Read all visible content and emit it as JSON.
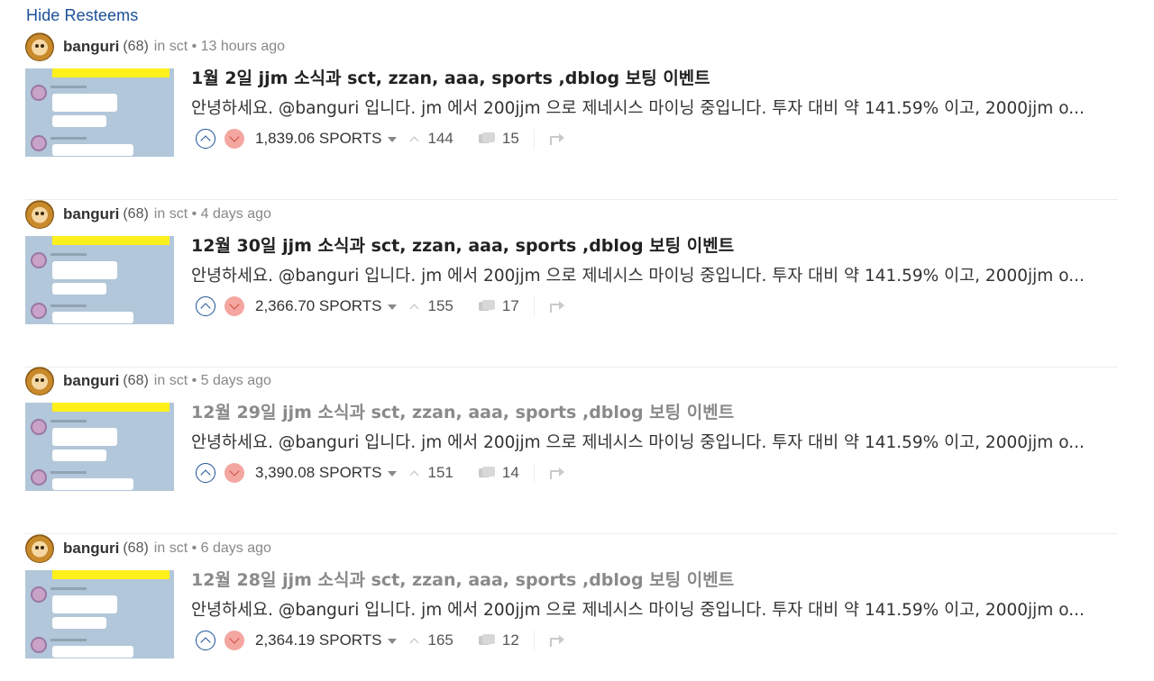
{
  "hide_resteems_label": "Hide Resteems",
  "posts": [
    {
      "author": "banguri",
      "reputation": "(68)",
      "meta": "in sct • 13 hours ago",
      "title": "1월 2일 jjm 소식과 sct, zzan, aaa, sports ,dblog 보팅 이벤트",
      "visited": false,
      "body": "안녕하세요. @banguri 입니다. jm 에서 200jjm 으로 제네시스 마이닝 중입니다. 투자 대비 약 141.59% 이고, 2000jjm o...",
      "payout": "1,839.06 SPORTS",
      "votes": "144",
      "replies": "15"
    },
    {
      "author": "banguri",
      "reputation": "(68)",
      "meta": "in sct • 4 days ago",
      "title": "12월 30일 jjm 소식과 sct, zzan, aaa, sports ,dblog 보팅 이벤트",
      "visited": false,
      "body": "안녕하세요. @banguri 입니다. jm 에서 200jjm 으로 제네시스 마이닝 중입니다. 투자 대비 약 141.59% 이고, 2000jjm o...",
      "payout": "2,366.70 SPORTS",
      "votes": "155",
      "replies": "17"
    },
    {
      "author": "banguri",
      "reputation": "(68)",
      "meta": "in sct • 5 days ago",
      "title": "12월 29일 jjm 소식과 sct, zzan, aaa, sports ,dblog 보팅 이벤트",
      "visited": true,
      "body": "안녕하세요. @banguri 입니다. jm 에서 200jjm 으로 제네시스 마이닝 중입니다. 투자 대비 약 141.59% 이고, 2000jjm o...",
      "payout": "3,390.08 SPORTS",
      "votes": "151",
      "replies": "14"
    },
    {
      "author": "banguri",
      "reputation": "(68)",
      "meta": "in sct • 6 days ago",
      "title": "12월 28일 jjm 소식과 sct, zzan, aaa, sports ,dblog 보팅 이벤트",
      "visited": true,
      "body": "안녕하세요. @banguri 입니다. jm 에서 200jjm 으로 제네시스 마이닝 중입니다. 투자 대비 약 141.59% 이고, 2000jjm o...",
      "payout": "2,364.19 SPORTS",
      "votes": "165",
      "replies": "12"
    }
  ]
}
